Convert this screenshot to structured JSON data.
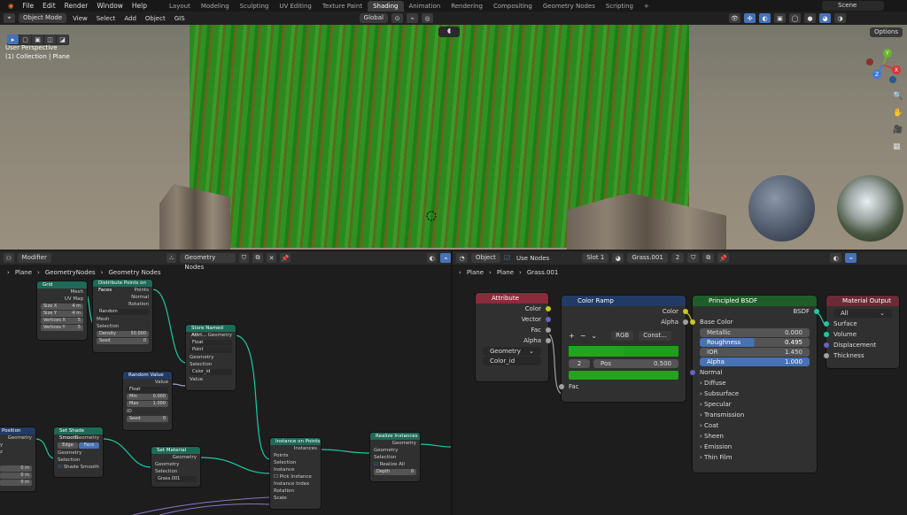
{
  "menu": [
    "File",
    "Edit",
    "Render",
    "Window",
    "Help"
  ],
  "workspaces": [
    "Layout",
    "Modeling",
    "Sculpting",
    "UV Editing",
    "Texture Paint",
    "Shading",
    "Animation",
    "Rendering",
    "Compositing",
    "Geometry Nodes",
    "Scripting",
    "+"
  ],
  "active_workspace": "Shading",
  "scene": "Scene",
  "viewport": {
    "mode": "Object Mode",
    "menus": [
      "View",
      "Select",
      "Add",
      "Object",
      "GIS"
    ],
    "orientation": "Global",
    "options": "Options",
    "overlay_title": "User Perspective",
    "overlay_sub": "(1) Collection | Plane",
    "gizmo": {
      "x": "X",
      "y": "Y",
      "z": "Z"
    }
  },
  "geo_editor": {
    "type": "Modifier",
    "tree": "Geometry Nodes",
    "breadcrumb": [
      "Plane",
      "GeometryNodes",
      "Geometry Nodes"
    ]
  },
  "shader_editor": {
    "type": "Object",
    "use_nodes": "Use Nodes",
    "slot": "Slot 1",
    "material": "Grass.001",
    "users": "2",
    "breadcrumb": [
      "Plane",
      "Plane",
      "Grass.001"
    ]
  },
  "gn_nodes": {
    "grid": {
      "title": "Grid",
      "mesh": "Mesh",
      "uvmap": "UV Map",
      "f1": [
        "Size X",
        "4 m"
      ],
      "f2": [
        "Size Y",
        "4 m"
      ],
      "f3": [
        "Vertices X",
        "5"
      ],
      "f4": [
        "Vertices Y",
        "5"
      ]
    },
    "dist": {
      "title": "Distribute Points on Faces",
      "out1": "Points",
      "out2": "Normal",
      "out3": "Rotation",
      "mode": "Random",
      "in1": "Mesh",
      "in2": "Selection",
      "f1": [
        "Density",
        "50.000"
      ],
      "f2": [
        "Seed",
        "0"
      ]
    },
    "store": {
      "title": "Store Named Attri...",
      "out": "Geometry",
      "s1": "Float",
      "s2": "Point",
      "in1": "Geometry",
      "in2": "Selection",
      "name": "Color_id",
      "in3": "Value"
    },
    "rand": {
      "title": "Random Value",
      "out": "Value",
      "s1": "Float",
      "f1": [
        "Min",
        "0.000"
      ],
      "f2": [
        "Max",
        "1.000"
      ],
      "in1": "ID",
      "f3": [
        "Seed",
        "0"
      ]
    },
    "pos": {
      "title": "Position",
      "out": "Geometry",
      "r1": "y",
      "r2": "z",
      "f1": "0 m",
      "f2": "0 m",
      "f3": "0 m"
    },
    "smooth": {
      "title": "Set Shade Smooth",
      "out": "Geometry",
      "b1": "Edge",
      "b2": "Face",
      "in1": "Geometry",
      "in2": "Selection",
      "chk": "Shade Smooth"
    },
    "setmat": {
      "title": "Set Material",
      "out": "Geometry",
      "in1": "Geometry",
      "in2": "Selection",
      "mat": "Grass.001"
    },
    "inst": {
      "title": "Instance on Points",
      "out": "Instances",
      "in1": "Points",
      "in2": "Selection",
      "in3": "Instance",
      "chk": "Pick Instance",
      "in4": "Instance Index",
      "in5": "Rotation",
      "in6": "Scale"
    },
    "realize": {
      "title": "Realize Instances",
      "out": "Geometry",
      "in1": "Geometry",
      "in2": "Selection",
      "chk": "Realize All",
      "f1": [
        "Depth",
        "0"
      ]
    }
  },
  "sh_nodes": {
    "attr": {
      "title": "Attribute",
      "o1": "Color",
      "o2": "Vector",
      "o3": "Fac",
      "o4": "Alpha",
      "type": "Geometry",
      "name": "Color_id"
    },
    "ramp": {
      "title": "Color Ramp",
      "o1": "Color",
      "o2": "Alpha",
      "mode": "RGB",
      "interp": "Const...",
      "stop": "2",
      "pos_label": "Pos",
      "pos_val": "0.500",
      "in": "Fac"
    },
    "bsdf": {
      "title": "Principled BSDF",
      "out": "BSDF",
      "base": "Base Color",
      "f1": [
        "Metallic",
        "0.000"
      ],
      "f2": [
        "Roughness",
        "0.495"
      ],
      "f3": [
        "IOR",
        "1.450"
      ],
      "f4": [
        "Alpha",
        "1.000"
      ],
      "normal": "Normal",
      "panels": [
        "Diffuse",
        "Subsurface",
        "Specular",
        "Transmission",
        "Coat",
        "Sheen",
        "Emission",
        "Thin Film"
      ]
    },
    "out": {
      "title": "Material Output",
      "target": "All",
      "s1": "Surface",
      "s2": "Volume",
      "s3": "Displacement",
      "s4": "Thickness"
    }
  },
  "colors": {
    "geo_header": "#1e6a57",
    "input_header": "#223b66",
    "shader_header": "#1f5e2a",
    "output_header": "#6b2a34",
    "attr_header": "#8a2a3b",
    "link": "#1ec9a0"
  }
}
